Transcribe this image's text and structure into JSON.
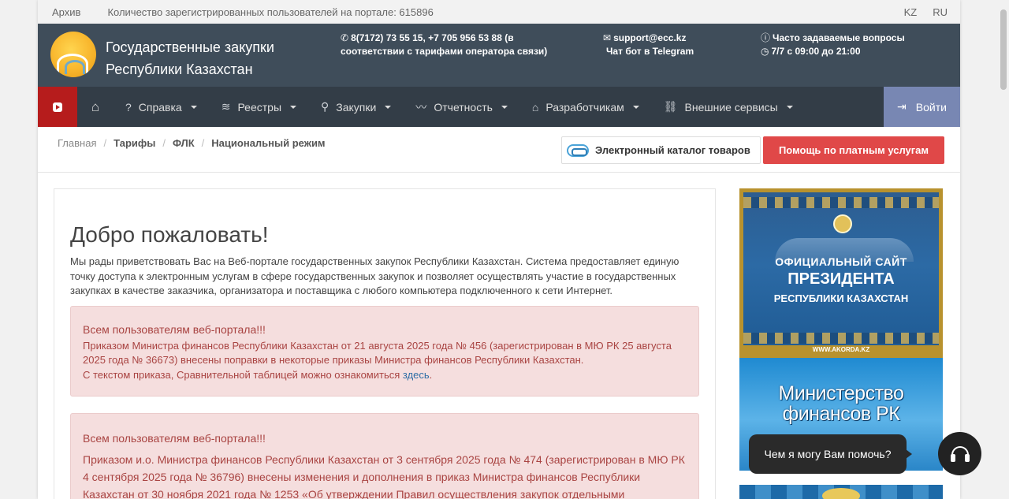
{
  "topbar": {
    "archive": "Архив",
    "users_text": "Количество зарегистрированных пользователей на портале: 615896",
    "lang_kz": "KZ",
    "lang_ru": "RU"
  },
  "header": {
    "brand_line1": "Государственные закупки",
    "brand_line2": "Республики Казахстан",
    "phone_line1": "8(7172) 73 55 15, +7 705 956 53 88 (в",
    "phone_line2": "соответствии с тарифами оператора связи)",
    "email": "support@ecc.kz",
    "telegram": "Чат бот в Telegram",
    "faq": "Часто задаваемые вопросы",
    "hours": "7/7 с 09:00 до 21:00"
  },
  "nav": {
    "items": [
      {
        "label": "Справка",
        "icon": "question-circle-icon"
      },
      {
        "label": "Реестры",
        "icon": "layers-icon"
      },
      {
        "label": "Закупки",
        "icon": "search-icon"
      },
      {
        "label": "Отчетность",
        "icon": "chart-line-icon"
      },
      {
        "label": "Разработчикам",
        "icon": "tag-icon"
      },
      {
        "label": "Внешние сервисы",
        "icon": "link-icon"
      }
    ],
    "login": "Войти"
  },
  "breadcrumbs": [
    "Главная",
    "Тарифы",
    "ФЛК",
    "Национальный режим"
  ],
  "buttons": {
    "catalog": "Электронный каталог товаров",
    "help": "Помощь по платным услугам"
  },
  "main": {
    "title": "Добро пожаловать!",
    "intro": "Мы рады приветствовать Вас на Веб-портале государственных закупок Республики Казахстан. Система предоставляет единую точку доступа к электронным услугам в сфере государственных закупок и позволяет осуществлять участие в государственных закупках в качестве заказчика, организатора и поставщика с любого компьютера подключенного к сети Интернет.",
    "alert1": {
      "title": "Всем пользователям веб-портала!!!",
      "body": "Приказом Министра финансов Республики Казахстан от 21 августа 2025 года № 456 (зарегистрирован в МЮ РК 25 августа 2025 года № 36673) внесены поправки в некоторые приказы Министра финансов Республики Казахстан.",
      "link_prefix": "С текстом приказа, Сравнительной таблицей можно ознакомиться ",
      "link_text": "здесь",
      "link_suffix": "."
    },
    "alert2": {
      "title": "Всем пользователям веб-портала!!!",
      "body": "Приказом и.о. Министра финансов Республики Казахстан от 3 сентября 2025 года № 474 (зарегистрирован в МЮ РК 4 сентября 2025 года № 36796) внесены изменения и дополнения в приказ Министра финансов Республики Казахстан от 30 ноября 2021 года № 1253 «Об утверждении Правил осуществления закупок отдельными"
    }
  },
  "sidebar": {
    "banner1_line1": "ОФИЦИАЛЬНЫЙ САЙТ",
    "banner1_line2": "ПРЕЗИДЕНТА",
    "banner1_line3": "РЕСПУБЛИКИ КАЗАХСТАН",
    "banner1_url": "WWW.AKORDA.KZ",
    "banner2_line1": "Министерство",
    "banner2_line2": "финансов РК"
  },
  "chat": {
    "prompt": "Чем я могу Вам помочь?"
  },
  "colors": {
    "header_bg": "#3f4d5a",
    "nav_bg": "#333d47",
    "youtube_red": "#b61c1c",
    "login_bg": "#7887b3",
    "help_red": "#e04848",
    "alert_bg": "#f5dede",
    "alert_text": "#a94442"
  }
}
